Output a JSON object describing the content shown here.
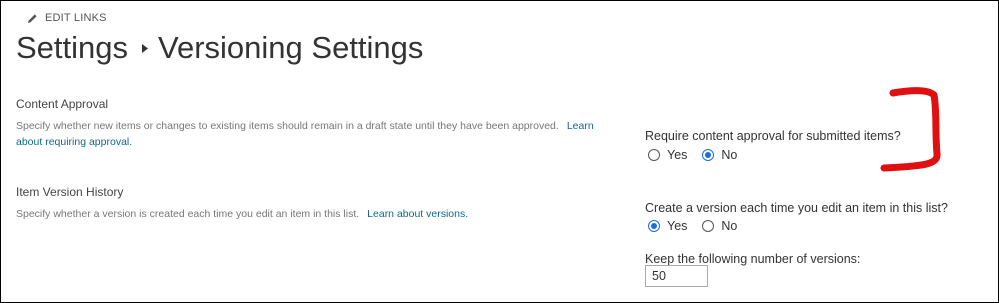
{
  "toolbar": {
    "edit_links_label": "EDIT LINKS",
    "edit_icon": "pencil-icon"
  },
  "breadcrumb": {
    "parent": "Settings",
    "separator_icon": "triangle-right-icon",
    "current": "Versioning Settings"
  },
  "sections": {
    "content_approval": {
      "title": "Content Approval",
      "description": "Specify whether new items or changes to existing items should remain in a draft state until they have been approved.",
      "link_text": "Learn about requiring approval.",
      "question": "Require content approval for submitted items?",
      "options": [
        {
          "label": "Yes",
          "checked": false
        },
        {
          "label": "No",
          "checked": true
        }
      ]
    },
    "version_history": {
      "title": "Item Version History",
      "description": "Specify whether a version is created each time you edit an item in this list.",
      "link_text": "Learn about versions.",
      "question": "Create a version each time you edit an item in this list?",
      "options": [
        {
          "label": "Yes",
          "checked": true
        },
        {
          "label": "No",
          "checked": false
        }
      ],
      "keep_versions_label": "Keep the following number of versions:",
      "keep_versions_value": "50"
    }
  },
  "colors": {
    "link": "#0f6a8b",
    "radio_checked": "#1a6fe0",
    "annotation": "#e01010"
  }
}
